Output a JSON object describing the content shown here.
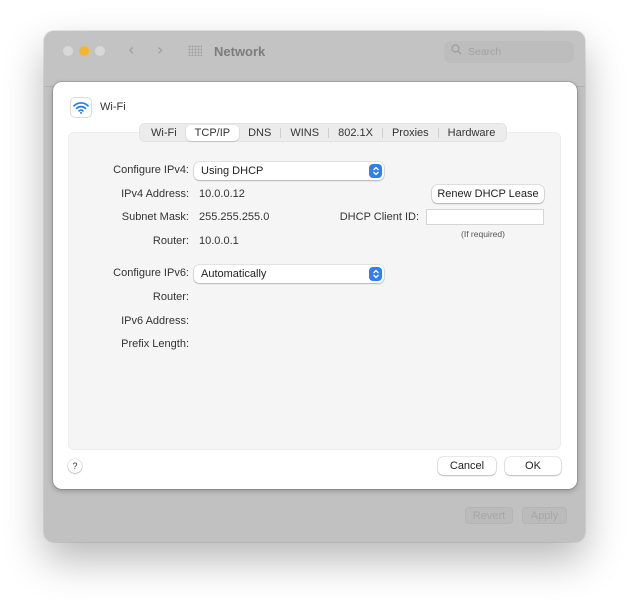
{
  "window": {
    "title": "Network",
    "search_placeholder": "Search",
    "revert_label": "Revert",
    "apply_label": "Apply",
    "traffic_light_min_color": "#f6b62c"
  },
  "sheet": {
    "service_name": "Wi-Fi",
    "service_icon": "wifi-icon",
    "tabs": [
      {
        "label": "Wi-Fi",
        "active": false
      },
      {
        "label": "TCP/IP",
        "active": true
      },
      {
        "label": "DNS",
        "active": false
      },
      {
        "label": "WINS",
        "active": false
      },
      {
        "label": "802.1X",
        "active": false
      },
      {
        "label": "Proxies",
        "active": false
      },
      {
        "label": "Hardware",
        "active": false
      }
    ],
    "ipv4": {
      "configure_label": "Configure IPv4:",
      "configure_value": "Using DHCP",
      "address_label": "IPv4 Address:",
      "address_value": "10.0.0.12",
      "subnet_label": "Subnet Mask:",
      "subnet_value": "255.255.255.0",
      "router_label": "Router:",
      "router_value": "10.0.0.1",
      "renew_button": "Renew DHCP Lease",
      "client_id_label": "DHCP Client ID:",
      "client_id_value": "",
      "client_id_hint": "(If required)"
    },
    "ipv6": {
      "configure_label": "Configure IPv6:",
      "configure_value": "Automatically",
      "router_label": "Router:",
      "address_label": "IPv6 Address:",
      "prefix_label": "Prefix Length:"
    },
    "help_label": "?",
    "cancel_label": "Cancel",
    "ok_label": "OK",
    "accent_color": "#2f7ff0"
  }
}
